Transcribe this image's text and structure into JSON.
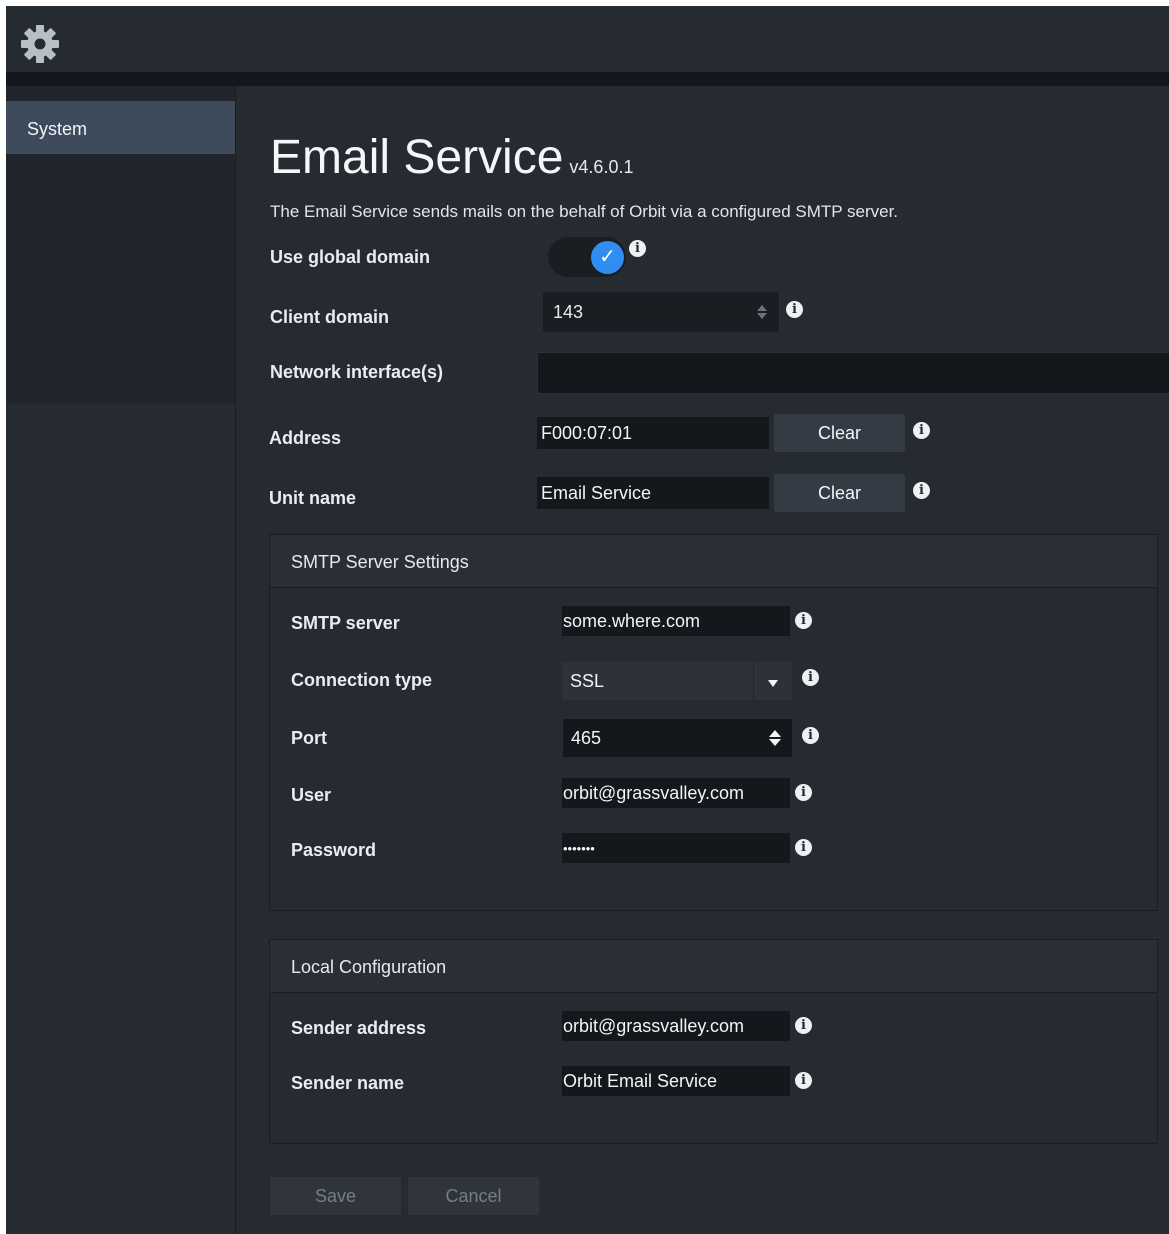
{
  "topbar": {
    "icon": "gear-icon"
  },
  "sidebar": {
    "items": [
      {
        "label": "System"
      }
    ]
  },
  "header": {
    "title": "Email Service",
    "version": "v4.6.0.1"
  },
  "description": "The Email Service sends mails on the behalf of Orbit via a configured SMTP server.",
  "general": {
    "use_global_domain": {
      "label": "Use global domain",
      "checked": true
    },
    "client_domain": {
      "label": "Client domain",
      "value": "143"
    },
    "network_interfaces": {
      "label": "Network interface(s)",
      "value": ""
    },
    "address": {
      "label": "Address",
      "value": "F000:07:01",
      "clear_label": "Clear"
    },
    "unit_name": {
      "label": "Unit name",
      "value": "Email Service",
      "clear_label": "Clear"
    }
  },
  "smtp": {
    "title": "SMTP Server Settings",
    "server": {
      "label": "SMTP server",
      "value": "some.where.com"
    },
    "connection_type": {
      "label": "Connection type",
      "value": "SSL"
    },
    "port": {
      "label": "Port",
      "value": "465"
    },
    "user": {
      "label": "User",
      "value": "orbit@grassvalley.com"
    },
    "password": {
      "label": "Password",
      "value": "•••••••"
    }
  },
  "local": {
    "title": "Local Configuration",
    "sender_address": {
      "label": "Sender address",
      "value": "orbit@grassvalley.com"
    },
    "sender_name": {
      "label": "Sender name",
      "value": "Orbit Email Service"
    }
  },
  "actions": {
    "save_label": "Save",
    "cancel_label": "Cancel"
  },
  "colors": {
    "background": "#262a31",
    "input": "#14171b",
    "accent": "#2f8ef0",
    "sidebar_selected": "#3d4b5c"
  },
  "info_glyph": "i"
}
